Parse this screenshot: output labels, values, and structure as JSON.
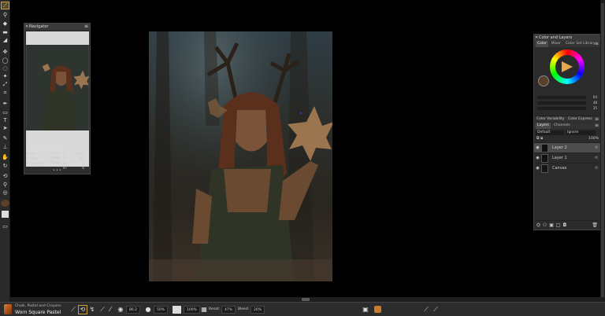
{
  "navigator": {
    "title": "Navigator",
    "zoom": "17%",
    "rotation": "0°",
    "width_label": "Width:",
    "width_value": "3500 Pixels",
    "height_label": "Height:",
    "height_value": "4791 Pixels",
    "resolution_label": "Resolution:",
    "resolution_value": "72 PPI",
    "x_label": "X:",
    "x_value": "1503",
    "y_label": "Y:",
    "y_value": "788",
    "w_label": "W:",
    "w_value": "0",
    "h_label": "H:",
    "h_value": "0"
  },
  "color_panel": {
    "title": "Color and Layers",
    "tabs": [
      "Color",
      "Mixer",
      "Color Set Library"
    ],
    "current_color": "#5a4029",
    "slider_values": [
      "64",
      "48",
      "35"
    ]
  },
  "color_sections": {
    "variability": "Color Variability",
    "express": "Color Express"
  },
  "layers_panel": {
    "tabs": [
      "Layers",
      "Channels"
    ],
    "composite": "Default",
    "composite_method": "Ignore",
    "opacity": "100%",
    "layers": [
      "Layer 2",
      "Layer 1",
      "Canvas"
    ]
  },
  "brush": {
    "category": "Chalk, Pastel and Crayons",
    "variant": "Worn Square Pastel",
    "size": "86.2",
    "opacity": "50%",
    "zoom": "100%",
    "resat_label": "Resat:",
    "resat_value": "47%",
    "bleed_label": "Bleed:",
    "bleed_value": "20%"
  }
}
